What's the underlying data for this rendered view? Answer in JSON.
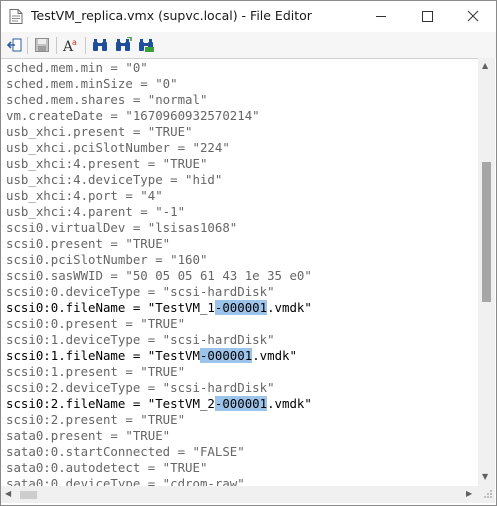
{
  "window": {
    "title": "TestVM_replica.vmx (supvc.local) - File Editor"
  },
  "toolbar": {
    "buttons": [
      {
        "name": "exit-icon"
      },
      {
        "name": "save-icon"
      },
      {
        "name": "font-icon"
      },
      {
        "name": "find-icon"
      },
      {
        "name": "find-next-icon"
      },
      {
        "name": "replace-icon"
      }
    ]
  },
  "editor": {
    "lines": [
      {
        "text": "sched.mem.min = \"0\""
      },
      {
        "text": "sched.mem.minSize = \"0\""
      },
      {
        "text": "sched.mem.shares = \"normal\""
      },
      {
        "text": "vm.createDate = \"1670960932570214\""
      },
      {
        "text": "usb_xhci.present = \"TRUE\""
      },
      {
        "text": "usb_xhci.pciSlotNumber = \"224\""
      },
      {
        "text": "usb_xhci:4.present = \"TRUE\""
      },
      {
        "text": "usb_xhci:4.deviceType = \"hid\""
      },
      {
        "text": "usb_xhci:4.port = \"4\""
      },
      {
        "text": "usb_xhci:4.parent = \"-1\""
      },
      {
        "text": "scsi0.virtualDev = \"lsisas1068\""
      },
      {
        "text": "scsi0.present = \"TRUE\""
      },
      {
        "text": "scsi0.pciSlotNumber = \"160\""
      },
      {
        "text": "scsi0.sasWWID = \"50 05 05 61 43 1e 35 e0\""
      },
      {
        "text": "scsi0:0.deviceType = \"scsi-hardDisk\""
      },
      {
        "text": "scsi0:0.fileName = \"TestVM_1-000001.vmdk\"",
        "highlight": true,
        "pre": "scsi0:0.fileName = \"TestVM_1",
        "sel": "-000001",
        "post": ".vmdk\""
      },
      {
        "text": "scsi0:0.present = \"TRUE\""
      },
      {
        "text": "scsi0:1.deviceType = \"scsi-hardDisk\""
      },
      {
        "text": "scsi0:1.fileName = \"TestVM-000001.vmdk\"",
        "highlight": true,
        "pre": "scsi0:1.fileName = \"TestVM",
        "sel": "-000001",
        "post": ".vmdk\""
      },
      {
        "text": "scsi0:1.present = \"TRUE\""
      },
      {
        "text": "scsi0:2.deviceType = \"scsi-hardDisk\""
      },
      {
        "text": "scsi0:2.fileName = \"TestVM_2-000001.vmdk\"",
        "highlight": true,
        "pre": "scsi0:2.fileName = \"TestVM_2",
        "sel": "-000001",
        "post": ".vmdk\""
      },
      {
        "text": "scsi0:2.present = \"TRUE\""
      },
      {
        "text": "sata0.present = \"TRUE\""
      },
      {
        "text": "sata0:0.startConnected = \"FALSE\""
      },
      {
        "text": "sata0:0.autodetect = \"TRUE\""
      },
      {
        "text": "sata0:0.deviceType = \"cdrom-raw\""
      }
    ]
  },
  "colors": {
    "selection": "#9cc3ea",
    "dimmed_text": "#666666",
    "highlight_text": "#000000"
  }
}
